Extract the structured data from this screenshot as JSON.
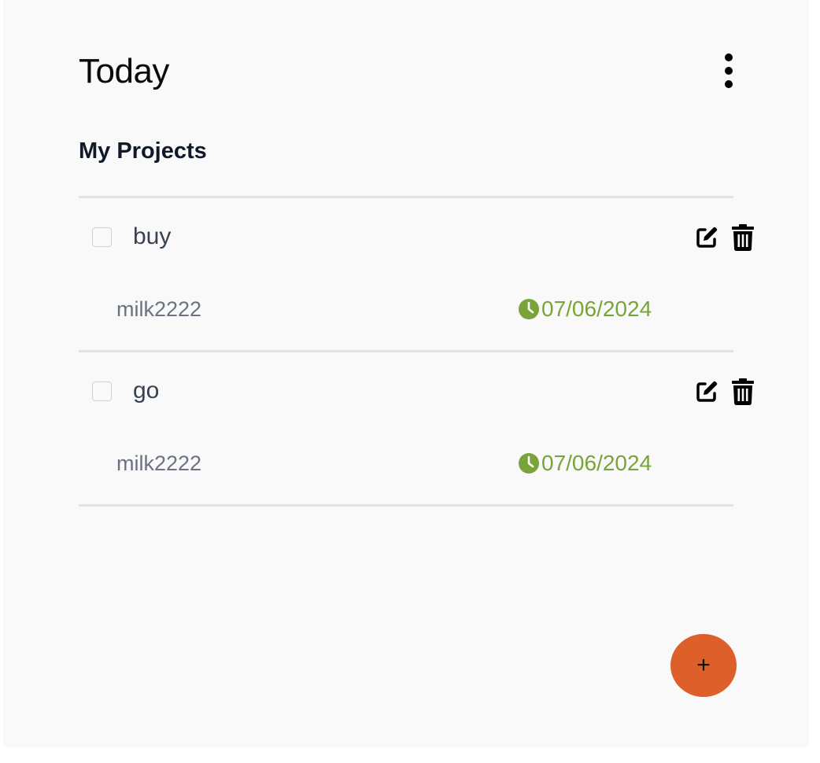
{
  "header": {
    "title": "Today",
    "menu_icon": "kebab-menu-icon"
  },
  "section": {
    "title": "My Projects"
  },
  "tasks": [
    {
      "title": "buy",
      "description": "milk2222",
      "due_date": "07/06/2024",
      "completed": false
    },
    {
      "title": "go",
      "description": "milk2222",
      "due_date": "07/06/2024",
      "completed": false
    }
  ],
  "icons": {
    "edit": "edit-icon",
    "delete": "trash-icon",
    "clock": "clock-icon"
  },
  "fab": {
    "label": "+"
  },
  "colors": {
    "background": "#f9f9f9",
    "date_green": "#7aa33a",
    "fab_orange": "#dd5f2a",
    "divider": "#e2e2e2"
  }
}
